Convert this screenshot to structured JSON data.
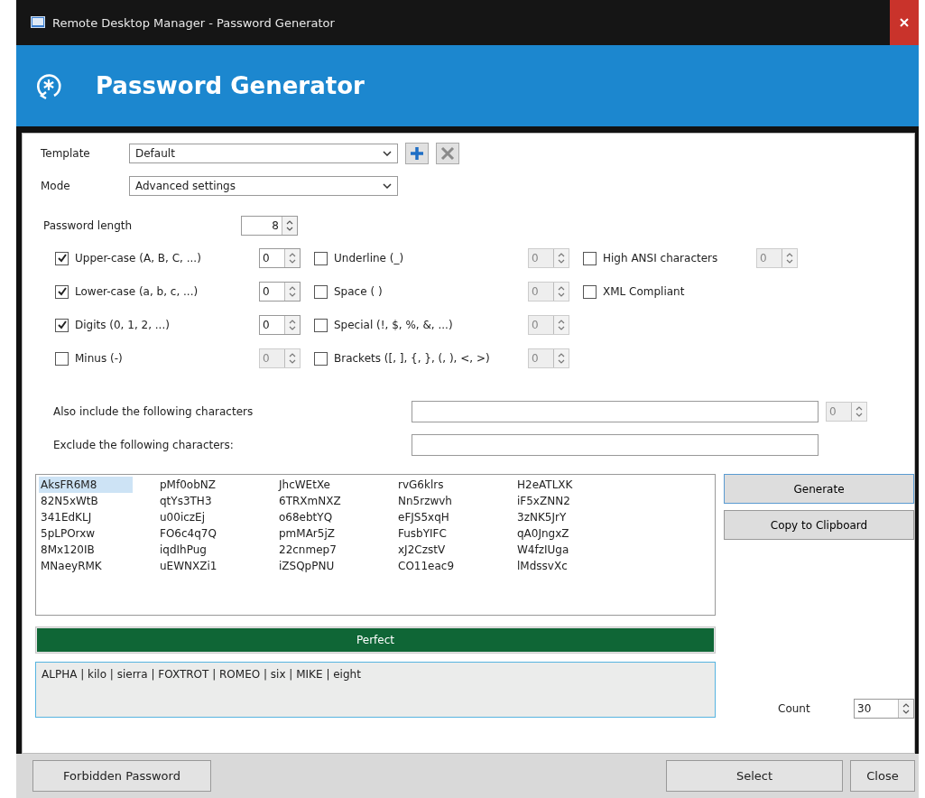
{
  "window": {
    "title": "Remote Desktop Manager - Password Generator"
  },
  "header": {
    "title": "Password Generator"
  },
  "template": {
    "label": "Template",
    "value": "Default"
  },
  "mode": {
    "label": "Mode",
    "value": "Advanced settings"
  },
  "password_length": {
    "label": "Password length",
    "value": "8"
  },
  "option_columns": [
    [
      {
        "label": "Upper-case (A, B, C, ...)",
        "checked": true,
        "count": "0"
      },
      {
        "label": "Lower-case (a, b, c, ...)",
        "checked": true,
        "count": "0"
      },
      {
        "label": "Digits (0, 1, 2, ...)",
        "checked": true,
        "count": "0"
      },
      {
        "label": "Minus (-)",
        "checked": false,
        "count": "0"
      }
    ],
    [
      {
        "label": "Underline (_)",
        "checked": false,
        "count": "0"
      },
      {
        "label": "Space ( )",
        "checked": false,
        "count": "0"
      },
      {
        "label": "Special (!, $, %, &, ...)",
        "checked": false,
        "count": "0"
      },
      {
        "label": "Brackets ([, ], {, }, (, ), <, >)",
        "checked": false,
        "count": "0"
      }
    ],
    [
      {
        "label": "High ANSI characters",
        "checked": false,
        "count": "0"
      },
      {
        "label": "XML Compliant",
        "checked": false
      }
    ]
  ],
  "include": {
    "label": "Also include the following characters",
    "count": "0"
  },
  "exclude": {
    "label": "Exclude the following characters:"
  },
  "passwords": [
    {
      "text": "AksFR6M8",
      "selected": true
    },
    {
      "text": "82N5xWtB",
      "selected": false
    },
    {
      "text": "341EdKLJ",
      "selected": false
    },
    {
      "text": "5pLPOrxw",
      "selected": false
    },
    {
      "text": "8Mx120IB",
      "selected": false
    },
    {
      "text": "MNaeyRMK",
      "selected": false
    },
    {
      "text": "pMf0obNZ",
      "selected": false
    },
    {
      "text": "qtYs3TH3",
      "selected": false
    },
    {
      "text": "u00iczEj",
      "selected": false
    },
    {
      "text": "FO6c4q7Q",
      "selected": false
    },
    {
      "text": "iqdIhPug",
      "selected": false
    },
    {
      "text": "uEWNXZi1",
      "selected": false
    },
    {
      "text": "JhcWEtXe",
      "selected": false
    },
    {
      "text": "6TRXmNXZ",
      "selected": false
    },
    {
      "text": "o68ebtYQ",
      "selected": false
    },
    {
      "text": "pmMAr5jZ",
      "selected": false
    },
    {
      "text": "22cnmep7",
      "selected": false
    },
    {
      "text": "iZSQpPNU",
      "selected": false
    },
    {
      "text": "rvG6klrs",
      "selected": false
    },
    {
      "text": "Nn5rzwvh",
      "selected": false
    },
    {
      "text": "eFJS5xqH",
      "selected": false
    },
    {
      "text": "FusbYIFC",
      "selected": false
    },
    {
      "text": "xJ2CzstV",
      "selected": false
    },
    {
      "text": "CO11eac9",
      "selected": false
    },
    {
      "text": "H2eATLXK",
      "selected": false
    },
    {
      "text": "iF5xZNN2",
      "selected": false
    },
    {
      "text": "3zNK5JrY",
      "selected": false
    },
    {
      "text": "qA0JngxZ",
      "selected": false
    },
    {
      "text": "W4fzIUga",
      "selected": false
    },
    {
      "text": "lMdssvXc",
      "selected": false
    }
  ],
  "buttons": {
    "generate": "Generate",
    "copy": "Copy to Clipboard"
  },
  "strength": {
    "label": "Perfect",
    "level": 1
  },
  "phonetic": "ALPHA | kilo | sierra | FOXTROT | ROMEO | six | MIKE | eight",
  "count": {
    "label": "Count",
    "value": "30"
  },
  "footer": {
    "forbidden": "Forbidden Password",
    "select": "Select",
    "close": "Close"
  }
}
